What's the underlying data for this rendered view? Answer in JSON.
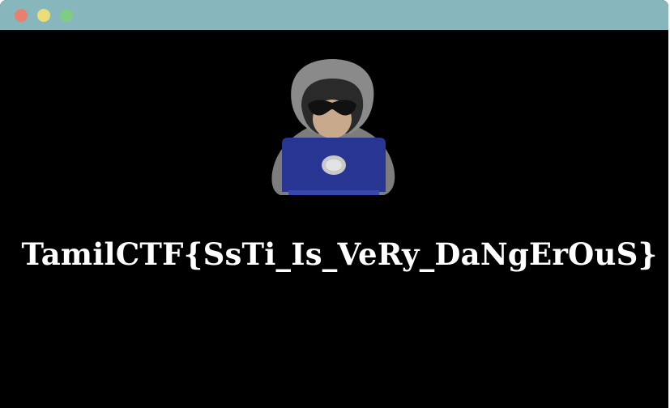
{
  "window": {
    "titlebar_color": "#88b6bd",
    "background_color": "#000000",
    "buttons": [
      {
        "name": "close",
        "color": "#e7806f"
      },
      {
        "name": "minimize",
        "color": "#e9dd77"
      },
      {
        "name": "maximize",
        "color": "#7ecd83"
      }
    ]
  },
  "content": {
    "illustration": "hooded-hacker-with-laptop-icon",
    "flag_text": "TamilCTF{SsTi_Is_VeRy_DaNgErOuS}"
  }
}
